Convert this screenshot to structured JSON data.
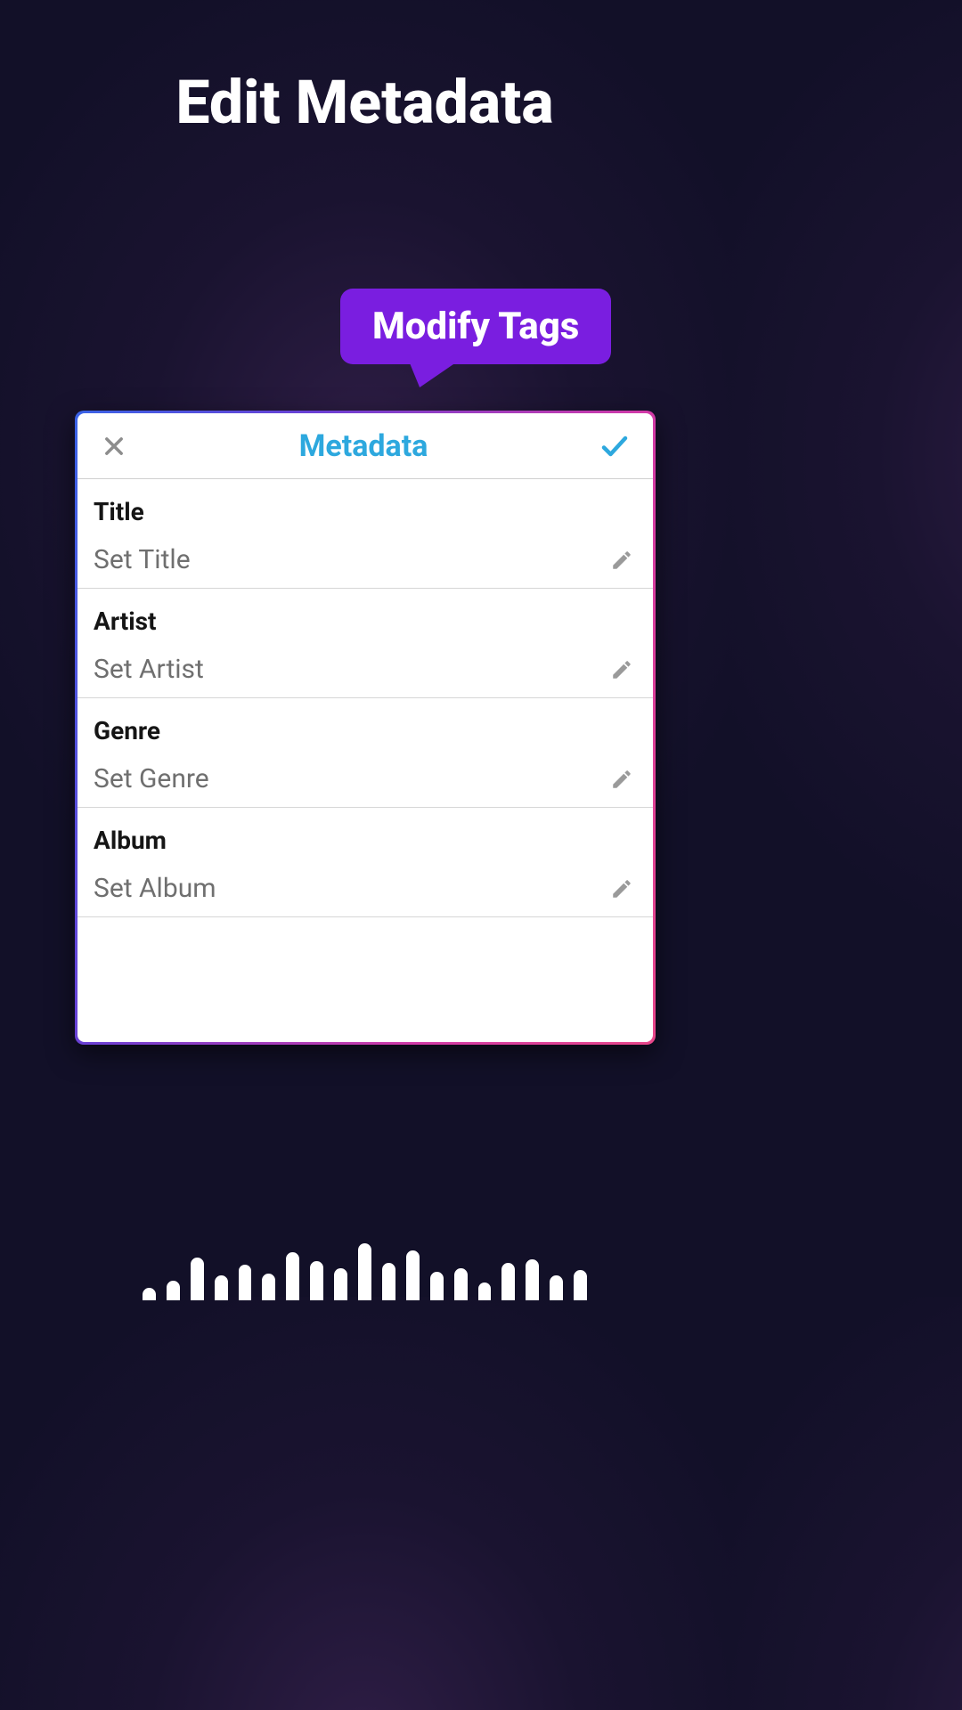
{
  "page": {
    "title": "Edit Metadata"
  },
  "tooltip": {
    "label": "Modify Tags"
  },
  "card": {
    "header_title": "Metadata",
    "fields": [
      {
        "label": "Title",
        "placeholder": "Set Title",
        "value": ""
      },
      {
        "label": "Artist",
        "placeholder": "Set Artist",
        "value": ""
      },
      {
        "label": "Genre",
        "placeholder": "Set Genre",
        "value": ""
      },
      {
        "label": "Album",
        "placeholder": "Set Album",
        "value": ""
      }
    ]
  },
  "icons": {
    "close": "close-icon",
    "confirm": "check-icon",
    "edit": "pencil-icon"
  },
  "colors": {
    "accent_purple": "#7a1ee0",
    "header_teal": "#2da8de",
    "gradient_start": "#3a63e6",
    "gradient_end": "#e8468a",
    "bg_dark": "#121028"
  },
  "waveform_heights": [
    14,
    22,
    48,
    28,
    40,
    30,
    54,
    44,
    36,
    64,
    42,
    56,
    32,
    36,
    20,
    42,
    46,
    28,
    34
  ]
}
